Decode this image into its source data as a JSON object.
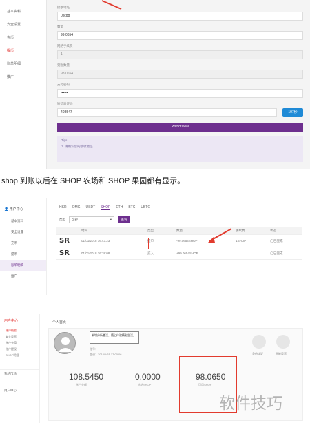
{
  "panel1": {
    "sidebar": [
      {
        "label": "基本资料",
        "active": false
      },
      {
        "label": "安全设置",
        "active": false
      },
      {
        "label": "充币",
        "active": false
      },
      {
        "label": "提币",
        "active": true
      },
      {
        "label": "账单明细",
        "active": false
      },
      {
        "label": "推广",
        "active": false
      }
    ],
    "fields": {
      "address_label": "接收地址",
      "address_value": "0xcdb",
      "amount_label": "数量",
      "amount_value": "99.0654",
      "fee_label": "网络手续费",
      "fee_value": "1",
      "received_label": "到账数量",
      "received_value": "98.0654",
      "paypwd_label": "支付密码",
      "paypwd_value": "••••••",
      "code_label": "短信验证码",
      "code_value": "408547",
      "code_button": "107秒",
      "withdraw_button": "Withdrawal",
      "tips_title": "Tips：",
      "tips_text": "1. 请确认您的接收地址……"
    }
  },
  "caption": "shop 到账以后在 SHOP 农场和 SHOP 果园都有显示。",
  "panel2": {
    "sidebar_head": "用户中心",
    "sidebar": [
      {
        "label": "基本资料",
        "active": false
      },
      {
        "label": "安全设置",
        "active": false
      },
      {
        "label": "充币",
        "active": false
      },
      {
        "label": "提币",
        "active": false
      },
      {
        "label": "账单明细",
        "active": true
      },
      {
        "label": "推广",
        "active": false
      }
    ],
    "tabs": [
      {
        "label": "HSR",
        "active": false
      },
      {
        "label": "OMG",
        "active": false
      },
      {
        "label": "USDT",
        "active": false
      },
      {
        "label": "SHOP",
        "active": true
      },
      {
        "label": "ETH",
        "active": false
      },
      {
        "label": "BTC",
        "active": false
      },
      {
        "label": "UBTC",
        "active": false
      }
    ],
    "filter_label": "类型",
    "filter_value": "全部",
    "query_button": "查询",
    "columns": [
      "",
      "时间",
      "类型",
      "数量",
      "手续费",
      "状态"
    ],
    "rows": [
      {
        "logo": "SR",
        "time": "01/01/2018 16:43:23",
        "type": "提币",
        "amount": "-99.0654SHOP",
        "fee": "1SHOP",
        "status": "已完成"
      },
      {
        "logo": "SR",
        "time": "01/01/2018 16:38:08",
        "type": "买入",
        "amount": "+99.0654SHOP",
        "fee": "",
        "status": "已完成"
      }
    ]
  },
  "panel3": {
    "sidebar_head": "用户中心",
    "sidebar": [
      {
        "label": "账户概要",
        "active": true
      },
      {
        "label": "安全设置",
        "active": false
      },
      {
        "label": "账户充值",
        "active": false
      },
      {
        "label": "账户提现",
        "active": false
      },
      {
        "label": "SHOP明细",
        "active": false
      }
    ],
    "sidebar_sections": [
      "我的市场",
      "用户中心"
    ],
    "page_title": "个人首页",
    "tooltip": "新增分析激活，随心体验精彩生活。",
    "user_lines": [
      "账号：",
      "登录：2018/1/31 17:00:06"
    ],
    "icons": [
      {
        "name": "id-card-icon",
        "label": "身份认证"
      },
      {
        "name": "wifi-icon",
        "label": "智能设置"
      }
    ],
    "stats": [
      {
        "value": "108.5450",
        "label": "账户金额"
      },
      {
        "value": "0.0000",
        "label": "冻结SHOP"
      },
      {
        "value": "98.0650",
        "label": "可用SHOP"
      }
    ],
    "watermark": "软件技巧",
    "accent": "#e23b2e"
  }
}
